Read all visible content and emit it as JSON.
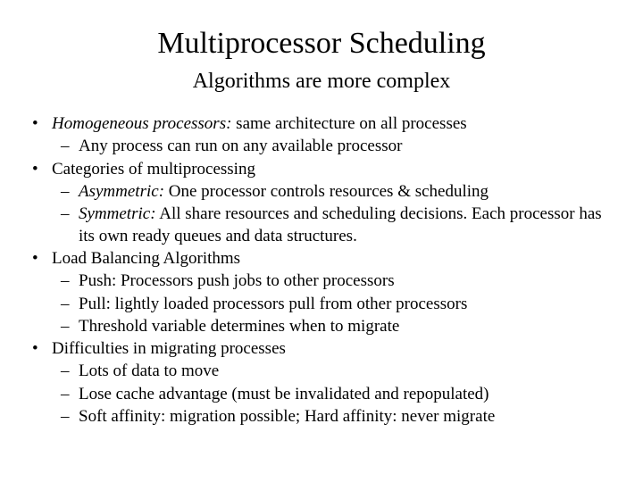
{
  "title": "Multiprocessor Scheduling",
  "subtitle": "Algorithms are more complex",
  "b1": {
    "term": "Homogeneous processors:",
    "rest": " same architecture on all processes",
    "s1": "Any process can run on any available processor"
  },
  "b2": {
    "text": "Categories of multiprocessing",
    "s1": {
      "term": "Asymmetric:",
      "rest": " One processor controls resources & scheduling"
    },
    "s2": {
      "term": "Symmetric:",
      "rest": " All share resources and scheduling decisions. Each processor has its own ready queues and data structures."
    }
  },
  "b3": {
    "text": "Load Balancing Algorithms",
    "s1": "Push: Processors push jobs to other processors",
    "s2": "Pull: lightly loaded processors pull from other processors",
    "s3": "Threshold variable determines when to migrate"
  },
  "b4": {
    "text": "Difficulties in migrating processes",
    "s1": "Lots of data to move",
    "s2": "Lose cache advantage (must be invalidated and repopulated)",
    "s3": "Soft affinity: migration possible; Hard affinity: never migrate"
  }
}
